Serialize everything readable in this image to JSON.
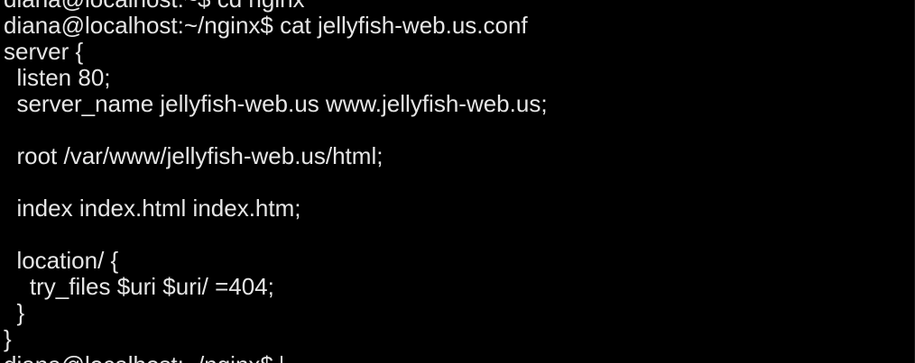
{
  "colors": {
    "background": "#000000",
    "foreground": "#e6e6e6"
  },
  "terminal": {
    "lines": [
      "diana@localhost:~$ cd nginx",
      "diana@localhost:~/nginx$ cat jellyfish-web.us.conf",
      "server {",
      "  listen 80;",
      "  server_name jellyfish-web.us www.jellyfish-web.us;",
      "",
      "  root /var/www/jellyfish-web.us/html;",
      "",
      "  index index.html index.htm;",
      "",
      "  location/ {",
      "    try_files $uri $uri/ =404;",
      "  }",
      "}",
      "diana@localhost:~/nginx$"
    ]
  }
}
